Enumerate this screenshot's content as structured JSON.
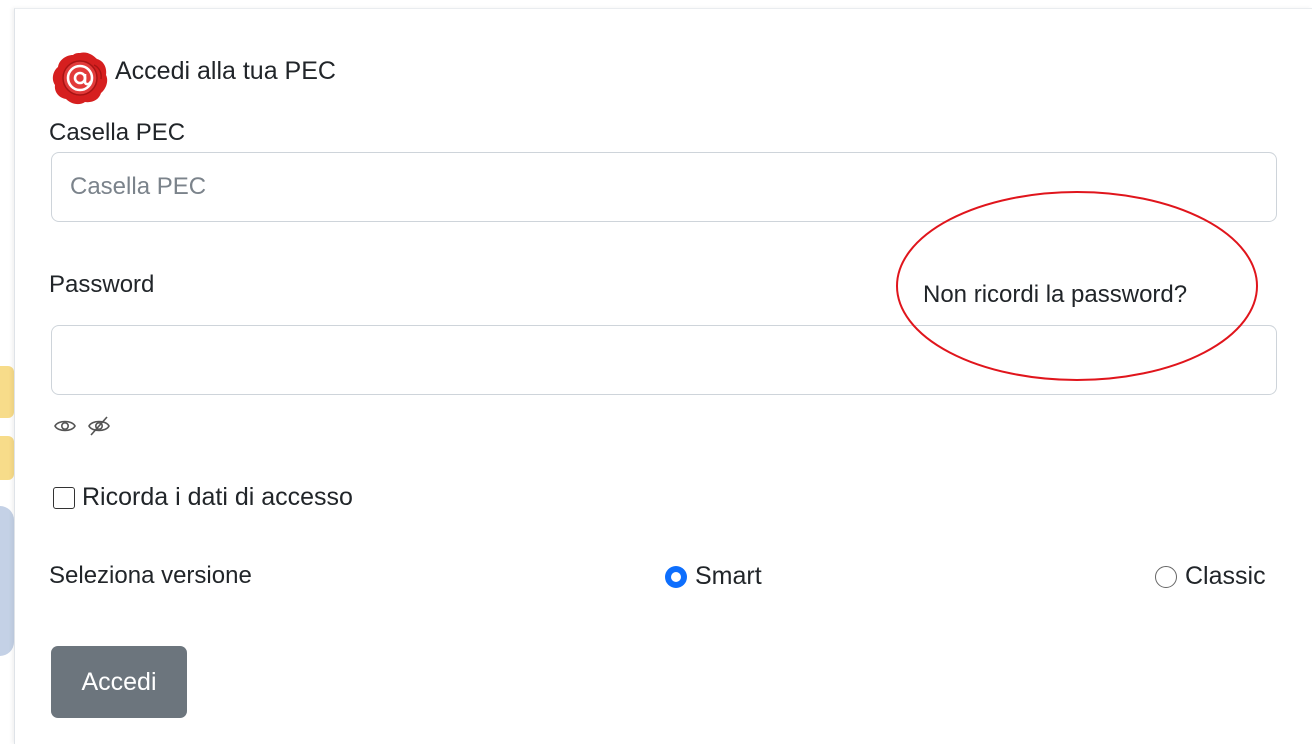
{
  "header": {
    "title": "Accedi alla tua PEC"
  },
  "mailbox": {
    "label": "Casella PEC",
    "placeholder": "Casella PEC",
    "value": ""
  },
  "password": {
    "label": "Password",
    "forgot_link": "Non ricordi la password?",
    "value": ""
  },
  "icons": {
    "logo": "pec-seal-icon",
    "show": "eye-icon",
    "hide": "eye-slash-icon"
  },
  "remember": {
    "label": "Ricorda i dati di accesso",
    "checked": false
  },
  "version": {
    "label": "Seleziona versione",
    "options": [
      {
        "label": "Smart",
        "selected": true
      },
      {
        "label": "Classic",
        "selected": false
      }
    ]
  },
  "submit": {
    "label": "Accedi"
  },
  "colors": {
    "primary": "#0d6efd",
    "button": "#6c757d",
    "annotation": "#e0151c",
    "seal": "#d61f1f"
  }
}
